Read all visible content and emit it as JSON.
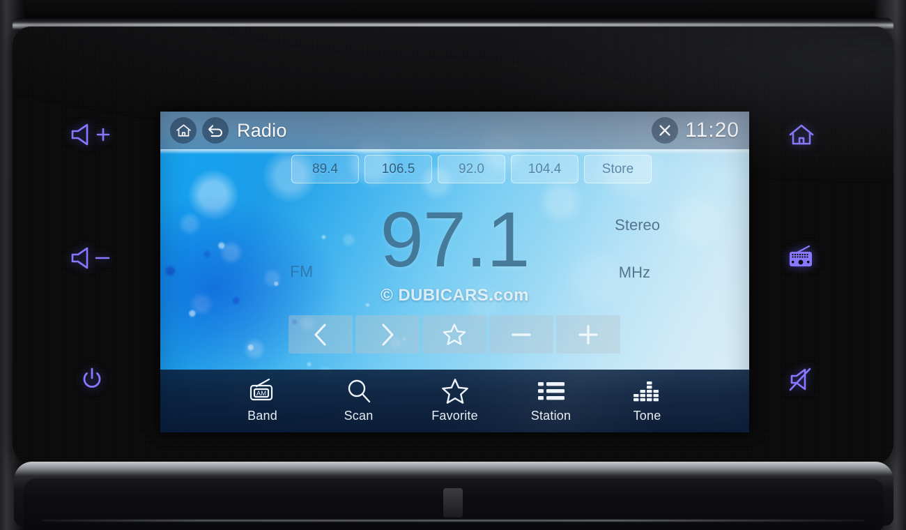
{
  "device": {
    "name": "car-infotainment-head-unit",
    "brand_accent": "#8878ff",
    "screen_accent": "#1aa6ef"
  },
  "screen": {
    "header": {
      "home_icon": "home-icon",
      "back_icon": "back-arrow-icon",
      "title": "Radio",
      "close_icon": "close-x-icon",
      "clock": "11:20"
    },
    "presets": [
      {
        "label": "89.4",
        "selected": true
      },
      {
        "label": "106.5",
        "selected": false
      },
      {
        "label": "92.0",
        "selected": false
      },
      {
        "label": "104.4",
        "selected": false
      },
      {
        "label": "Store",
        "selected": false
      }
    ],
    "tuner": {
      "band": "FM",
      "frequency": "97.1",
      "unit": "MHz",
      "stereo": "Stereo"
    },
    "watermark": "© DUBICARS.com",
    "controls": [
      {
        "name": "seek-down-button",
        "icon": "chevron-left-icon"
      },
      {
        "name": "seek-up-button",
        "icon": "chevron-right-icon"
      },
      {
        "name": "favorite-button",
        "icon": "star-icon"
      },
      {
        "name": "tune-down-button",
        "icon": "minus-icon"
      },
      {
        "name": "tune-up-button",
        "icon": "plus-icon"
      }
    ],
    "navbar": [
      {
        "label": "Band",
        "icon": "am-radio-icon"
      },
      {
        "label": "Scan",
        "icon": "search-icon"
      },
      {
        "label": "Favorite",
        "icon": "star-icon"
      },
      {
        "label": "Station",
        "icon": "list-icon"
      },
      {
        "label": "Tone",
        "icon": "equalizer-icon"
      }
    ]
  },
  "bezel": {
    "left_keys": [
      {
        "name": "volume-up-key",
        "icon": "speaker-plus-icon"
      },
      {
        "name": "volume-down-key",
        "icon": "speaker-minus-icon"
      },
      {
        "name": "power-key",
        "icon": "power-icon"
      }
    ],
    "right_keys": [
      {
        "name": "home-key",
        "icon": "home-icon"
      },
      {
        "name": "radio-key",
        "icon": "radio-icon"
      },
      {
        "name": "mute-key",
        "icon": "speaker-mute-icon"
      }
    ]
  }
}
